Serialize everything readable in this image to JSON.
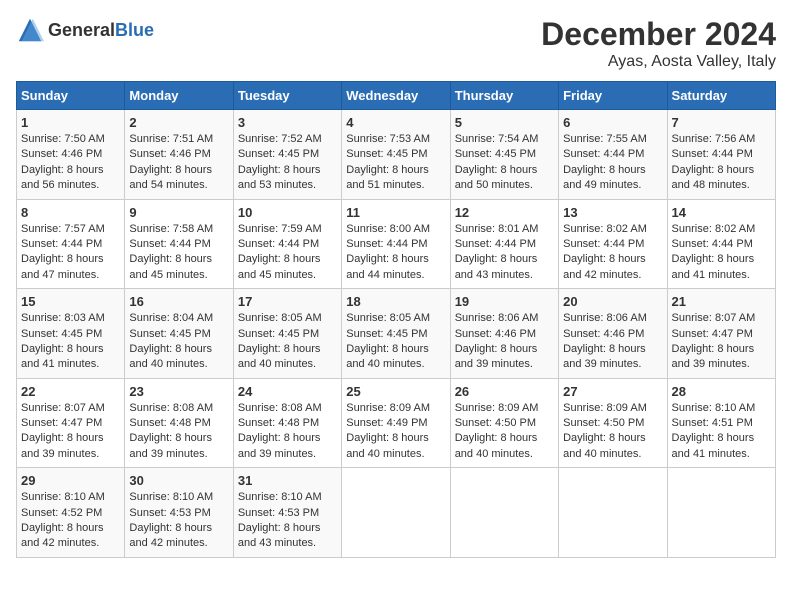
{
  "header": {
    "logo": {
      "text_general": "General",
      "text_blue": "Blue"
    },
    "title": "December 2024",
    "subtitle": "Ayas, Aosta Valley, Italy"
  },
  "calendar": {
    "days_of_week": [
      "Sunday",
      "Monday",
      "Tuesday",
      "Wednesday",
      "Thursday",
      "Friday",
      "Saturday"
    ],
    "weeks": [
      [
        null,
        null,
        null,
        null,
        null,
        null,
        null
      ]
    ],
    "cells": [
      [
        null,
        null,
        null,
        null,
        null,
        null,
        null
      ]
    ]
  }
}
